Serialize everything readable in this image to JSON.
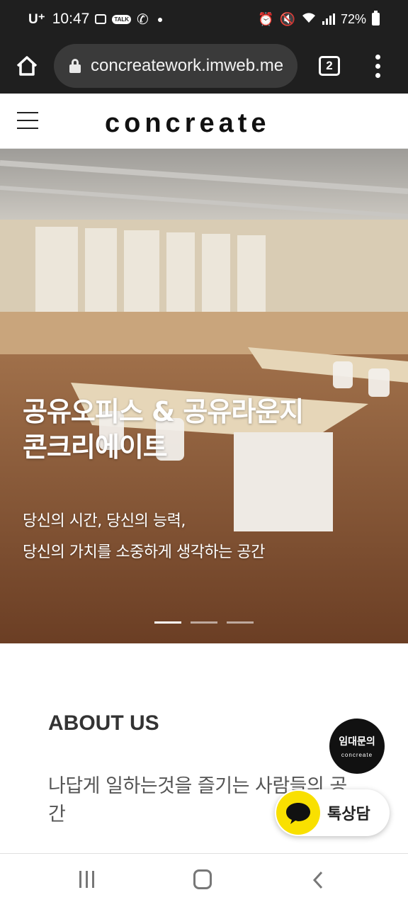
{
  "status_bar": {
    "carrier": "U⁺",
    "time": "10:47",
    "battery": "72%"
  },
  "browser": {
    "url": "concreatework.imweb.me",
    "tab_count": "2"
  },
  "site": {
    "logo_text": "concreate"
  },
  "hero": {
    "title_line1": "공유오피스 & 공유라운지",
    "title_line2": "콘크리에이트",
    "subtitle_line1": "당신의 시간, 당신의 능력,",
    "subtitle_line2": "당신의 가치를 소중하게 생각하는 공간",
    "slide_count": 3,
    "active_slide": 1
  },
  "about": {
    "heading": "ABOUT US",
    "text": "나답게 일하는것을 즐기는 사람들의 공간"
  },
  "floating": {
    "rent_inquiry": "임대문의",
    "rent_logo": "concreate",
    "kakao_talk": "톡상담"
  },
  "colors": {
    "status_bar_bg": "#1f1f1f",
    "kakao_yellow": "#f9e000",
    "floor_brown": "#8a5a3a"
  }
}
